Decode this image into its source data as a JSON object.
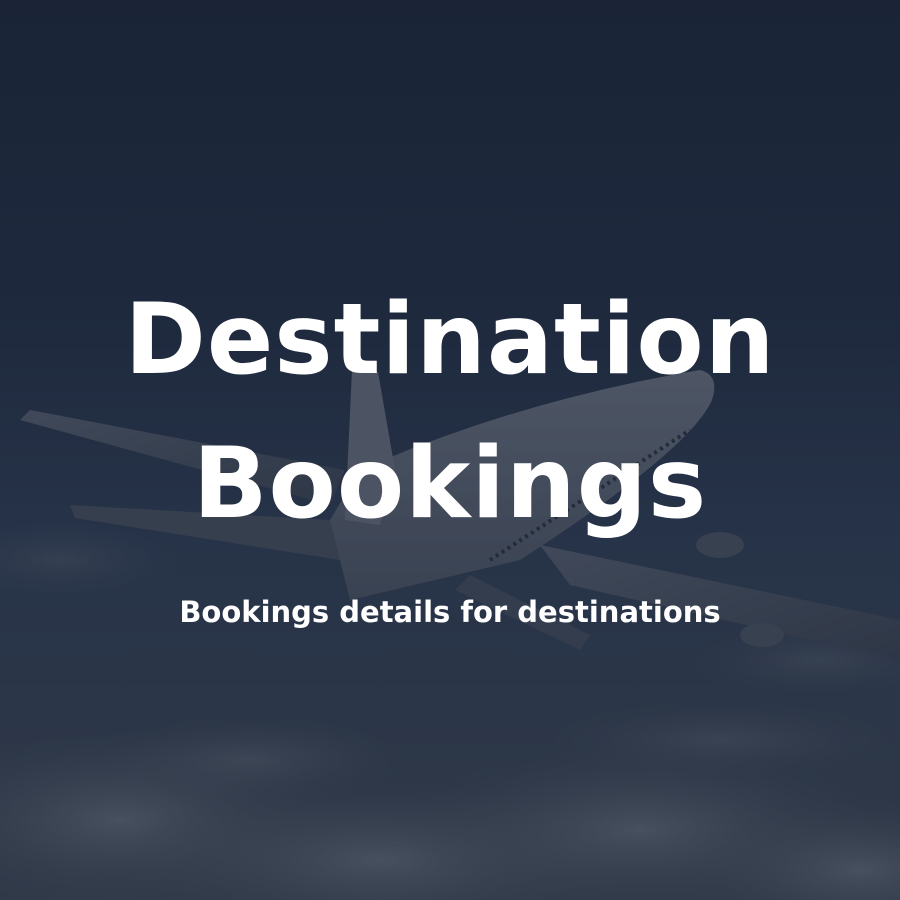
{
  "hero": {
    "title_line_1": "Destination",
    "title_line_2": "Bookings",
    "subtitle": "Bookings details for destinations"
  },
  "colors": {
    "text": "#ffffff",
    "sky_dark": "#1f2a3e",
    "sky_light": "#414b5a"
  }
}
